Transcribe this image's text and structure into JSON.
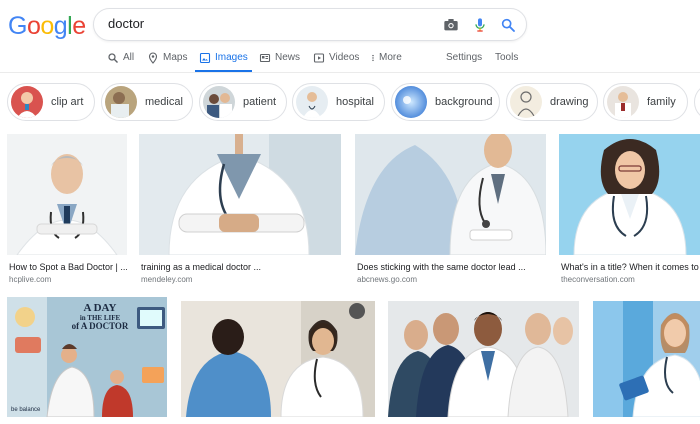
{
  "search": {
    "query": "doctor"
  },
  "logo": {
    "letters": [
      "G",
      "o",
      "o",
      "g",
      "l",
      "e"
    ],
    "colors": [
      "#4285f4",
      "#ea4335",
      "#fbbc05",
      "#4285f4",
      "#34a853",
      "#ea4335"
    ]
  },
  "tabs": [
    {
      "label": "All",
      "icon": "search-icon"
    },
    {
      "label": "Maps",
      "icon": "map-pin-icon"
    },
    {
      "label": "Images",
      "icon": "image-icon",
      "active": true
    },
    {
      "label": "News",
      "icon": "news-icon"
    },
    {
      "label": "Videos",
      "icon": "video-icon"
    },
    {
      "label": "More",
      "icon": "more-vertical-icon"
    },
    {
      "label": "Settings"
    },
    {
      "label": "Tools"
    }
  ],
  "chips": [
    {
      "label": "clip art"
    },
    {
      "label": "medical"
    },
    {
      "label": "patient"
    },
    {
      "label": "hospital"
    },
    {
      "label": "background"
    },
    {
      "label": "drawing"
    },
    {
      "label": "family"
    }
  ],
  "results": [
    {
      "title": "How to Spot a Bad Doctor | ...",
      "source": "hcplive.com"
    },
    {
      "title": "training as a medical doctor ...",
      "source": "mendeley.com"
    },
    {
      "title": "Does sticking with the same doctor lead ...",
      "source": "abcnews.go.com"
    },
    {
      "title": "What's in a title? When it comes to ...",
      "source": "theconversation.com"
    },
    {
      "poster_text": [
        "A DAY",
        "in THE LIFE",
        "of A DOCTOR"
      ],
      "poster_footer": "be balance"
    },
    {},
    {},
    {}
  ],
  "colors": {
    "accent": "#1a73e8",
    "muted": "#5f6368"
  }
}
